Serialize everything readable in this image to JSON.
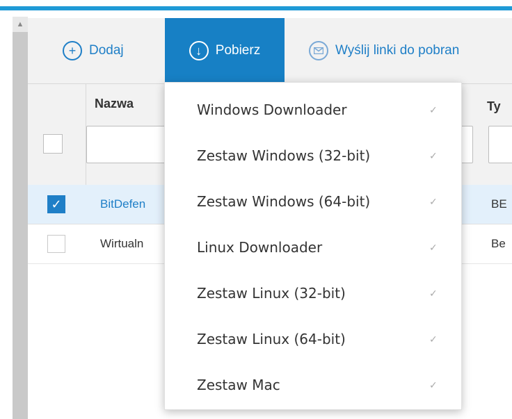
{
  "toolbar": {
    "add_label": "Dodaj",
    "download_label": "Pobierz",
    "send_label": "Wyślij linki do pobran",
    "icons": {
      "add": "plus-circle-icon",
      "download": "download-circle-icon",
      "send": "envelope-circle-icon"
    }
  },
  "table": {
    "columns": {
      "name": "Nazwa",
      "type": "Ty"
    },
    "rows": [
      {
        "checked": true,
        "name": "BitDefen",
        "type": "BE"
      },
      {
        "checked": false,
        "name": "Wirtualn",
        "type": "Be"
      }
    ]
  },
  "dropdown": {
    "items": [
      {
        "label": "Windows Downloader"
      },
      {
        "label": "Zestaw Windows (32-bit)"
      },
      {
        "label": "Zestaw Windows (64-bit)"
      },
      {
        "label": "Linux Downloader"
      },
      {
        "label": "Zestaw Linux (32-bit)"
      },
      {
        "label": "Zestaw Linux (64-bit)"
      },
      {
        "label": "Zestaw Mac"
      }
    ]
  },
  "colors": {
    "accent": "#1f9ad6",
    "button_active": "#1780c5",
    "link": "#1f7fc7",
    "selected_row": "#e3f0fb"
  }
}
